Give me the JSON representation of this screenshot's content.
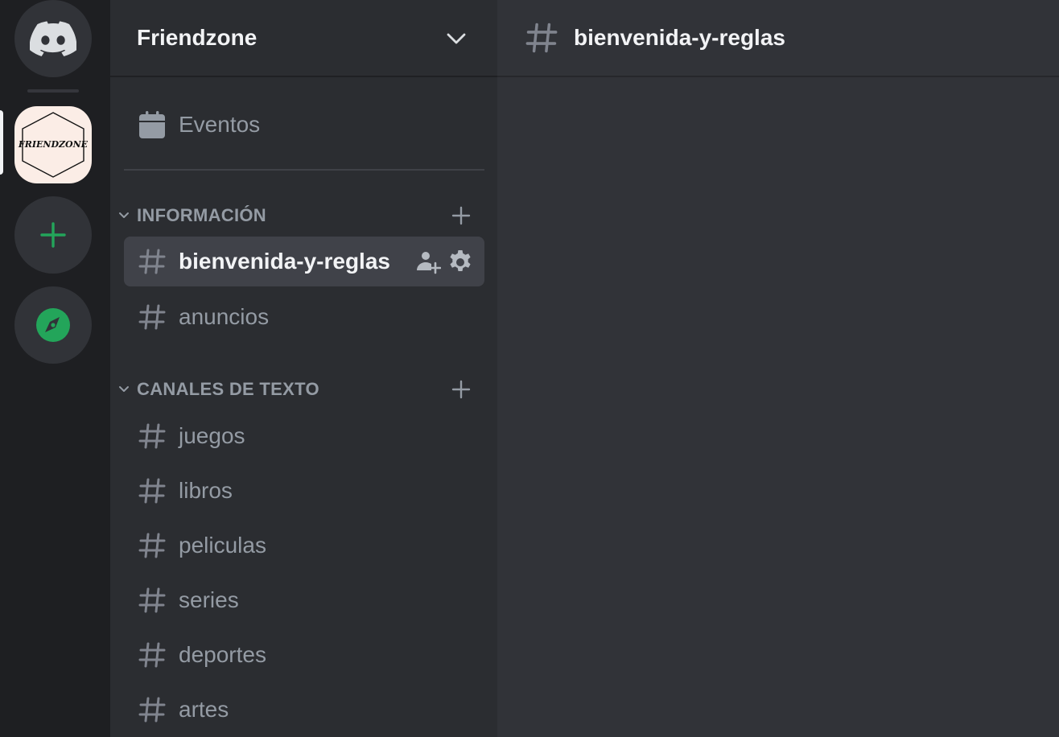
{
  "server_rail": {
    "home_icon": "discord-logo-icon",
    "server_logo_text": "FRIENDZONE",
    "add_icon": "plus-icon",
    "explore_icon": "compass-icon",
    "accent_green": "#23a55a"
  },
  "sidebar": {
    "server_name": "Friendzone",
    "events_label": "Eventos",
    "categories": [
      {
        "label": "INFORMACIÓN",
        "channels": [
          {
            "label": "bienvenida-y-reglas",
            "selected": true
          },
          {
            "label": "anuncios"
          }
        ]
      },
      {
        "label": "CANALES DE TEXTO",
        "channels": [
          {
            "label": "juegos"
          },
          {
            "label": "libros"
          },
          {
            "label": "peliculas"
          },
          {
            "label": "series"
          },
          {
            "label": "deportes"
          },
          {
            "label": "artes"
          }
        ]
      }
    ]
  },
  "main": {
    "channel_title": "bienvenida-y-reglas"
  }
}
